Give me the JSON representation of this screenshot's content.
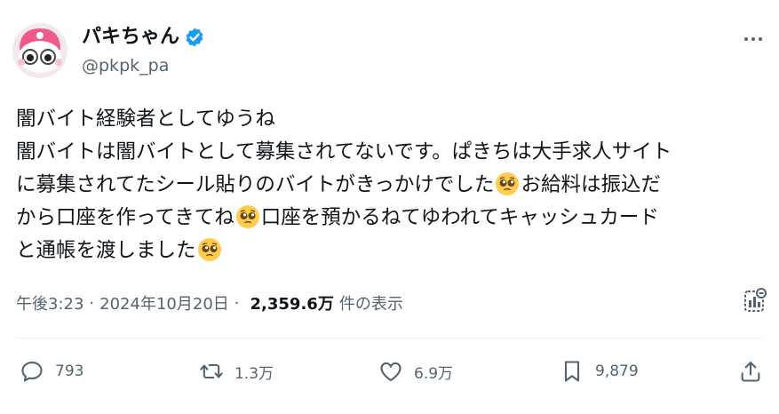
{
  "user": {
    "display_name": "パキちゃん",
    "handle": "@pkpk_pa",
    "verified": true,
    "avatar_icon": "character-avatar"
  },
  "more_icon": "more-dots-icon",
  "post": {
    "lines": [
      [
        "闇バイト経験者としてゆうね"
      ],
      [
        "闇バイトは闇バイトとして募集されてないです。ぱきちは大手求人サイト"
      ],
      [
        "に募集されてたシール貼りのバイトがきっかけでした",
        "🥺",
        "お給料は振込だ"
      ],
      [
        "から口座を作ってきてね",
        "🥺",
        "口座を預かるねてゆわれてキャッシュカード"
      ],
      [
        "と通帳を渡しました",
        "🥺"
      ]
    ]
  },
  "meta": {
    "time": "午後3:23",
    "separator1": "·",
    "date": "2024年10月20日",
    "separator2": "·",
    "views": "2,359.6万",
    "views_label": "件の表示"
  },
  "actions": {
    "reply": {
      "icon": "reply-icon",
      "count": "793"
    },
    "repost": {
      "icon": "repost-icon",
      "count": "1.3万"
    },
    "like": {
      "icon": "heart-icon",
      "count": "6.9万"
    },
    "bookmark": {
      "icon": "bookmark-icon",
      "count": "9,879"
    },
    "share": {
      "icon": "share-icon"
    }
  },
  "colors": {
    "text": "#0f1419",
    "secondary": "#536471",
    "verified": "#1d9bf0",
    "divider": "#eff3f4"
  }
}
